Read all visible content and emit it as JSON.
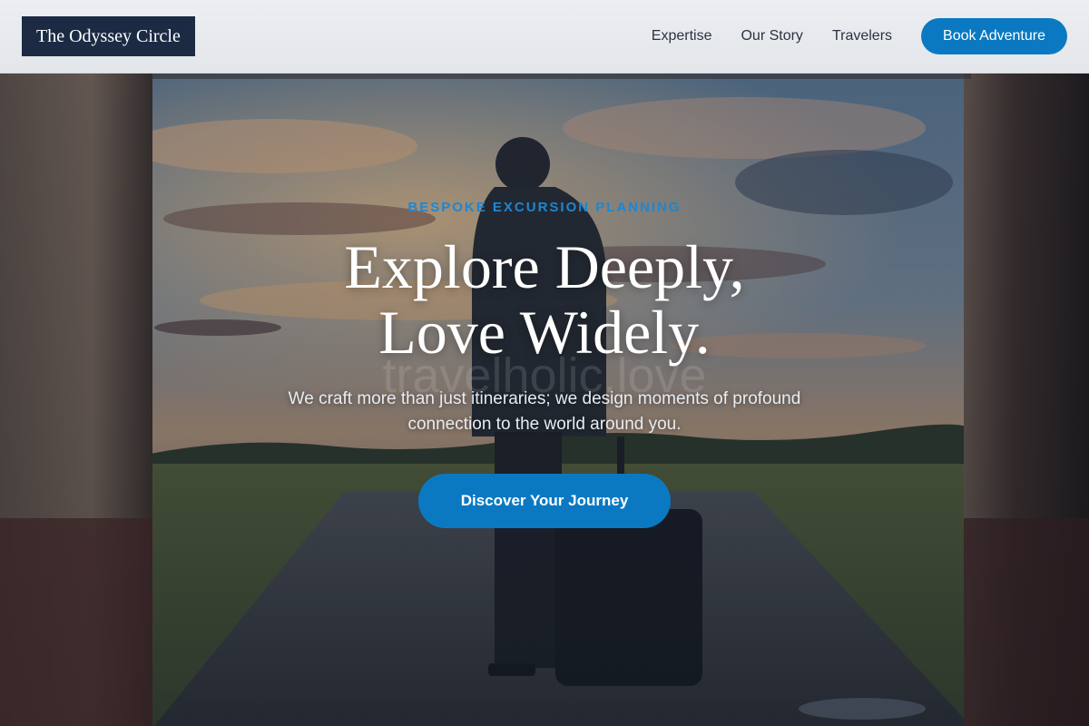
{
  "header": {
    "logo": "The Odyssey Circle",
    "nav": [
      {
        "label": "Expertise"
      },
      {
        "label": "Our Story"
      },
      {
        "label": "Travelers"
      }
    ],
    "cta": "Book Adventure"
  },
  "hero": {
    "eyebrow": "BESPOKE EXCURSION PLANNING",
    "headline_line1": "Explore Deeply,",
    "headline_line2": "Love Widely.",
    "subhead": "We craft more than just itineraries; we design moments of profound connection to the world around you.",
    "cta": "Discover Your Journey",
    "watermark": "travelholic.love"
  },
  "colors": {
    "accent": "#0a79c2",
    "logo_bg": "#1c2a44",
    "eyebrow": "#1f86d0",
    "header_bg": "#e6e8eb"
  },
  "icons": {
    "hero_image": "traveler-with-suitcase-photo"
  }
}
